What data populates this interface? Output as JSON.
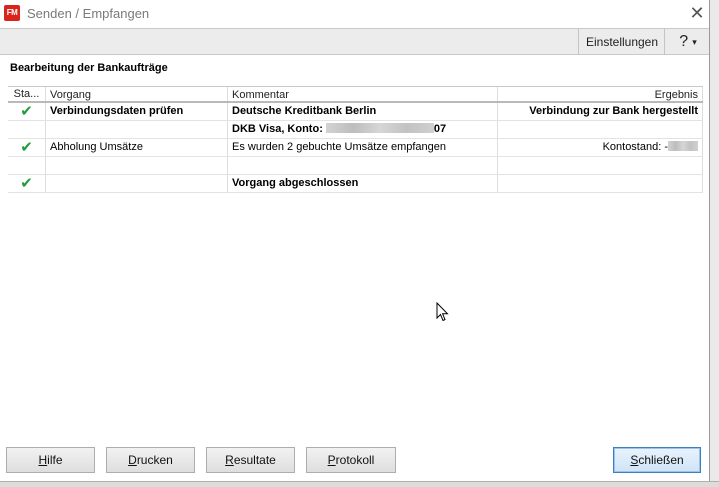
{
  "window": {
    "app_icon_text": "FM",
    "title": "Senden / Empfangen",
    "close_glyph": "✕"
  },
  "toolbar": {
    "settings_label": "Einstellungen",
    "help_label": "?",
    "help_caret": "▾"
  },
  "section_title": "Bearbeitung der Bankaufträge",
  "table": {
    "columns": [
      "Sta...",
      "Vorgang",
      "Kommentar",
      "Ergebnis"
    ],
    "rows": [
      {
        "status": "✔",
        "vorgang": "Verbindungsdaten prüfen",
        "kommentar": "Deutsche Kreditbank Berlin",
        "ergebnis": "Verbindung zur Bank hergestellt",
        "bold": true
      },
      {
        "status": "",
        "vorgang": "",
        "kommentar_prefix": "DKB Visa, Konto: ",
        "kommentar_suffix": "07",
        "ergebnis": "",
        "bold": true
      },
      {
        "status": "✔",
        "vorgang": "Abholung Umsätze",
        "kommentar": "Es wurden 2 gebuchte Umsätze empfangen",
        "ergebnis_prefix": "Kontostand: -",
        "bold": false
      },
      {
        "status": "",
        "vorgang": "",
        "kommentar": "",
        "ergebnis": "",
        "bold": false
      },
      {
        "status": "✔",
        "vorgang": "",
        "kommentar": "Vorgang abgeschlossen",
        "ergebnis": "",
        "bold": true
      }
    ]
  },
  "buttons": {
    "hilfe": {
      "accel": "H",
      "rest": "ilfe"
    },
    "drucken": {
      "accel": "D",
      "rest": "rucken"
    },
    "resultate": {
      "accel": "R",
      "rest": "esultate"
    },
    "protokoll": {
      "accel": "P",
      "rest": "rotokoll"
    },
    "schliessen": {
      "accel": "S",
      "rest": "chließen"
    }
  },
  "colors": {
    "check": "#1f9d3a",
    "app_icon": "#d9241c",
    "default_button_border": "#3c7fc1"
  }
}
